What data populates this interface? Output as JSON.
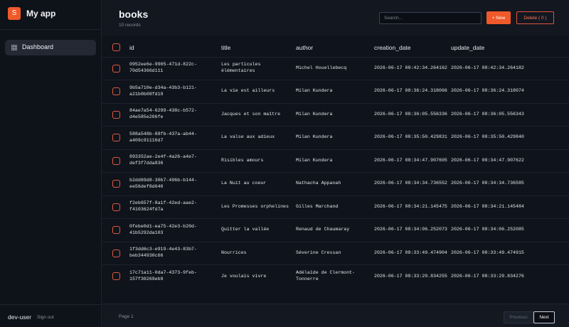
{
  "app": {
    "logo_letter": "S",
    "title": "My app"
  },
  "sidebar": {
    "items": [
      {
        "label": "Dashboard",
        "icon": "grid-icon"
      }
    ]
  },
  "user": {
    "name": "dev-user",
    "signout": "Sign out"
  },
  "header": {
    "title": "books",
    "subtitle": "10 records"
  },
  "search": {
    "placeholder": "Search..."
  },
  "toolbar": {
    "new_label": "+ New",
    "delete_label": "Delete ( 0 )"
  },
  "colors": {
    "accent": "#f0592a",
    "danger": "#e0553b",
    "background": "#0f131b"
  },
  "table": {
    "columns": [
      "id",
      "title",
      "author",
      "creation_date",
      "update_date"
    ],
    "rows": [
      [
        "0952ee6e-9905-471d-822c-70d54366d111",
        "Les particules élémentaires",
        "Michel Houellebecq",
        "2026-06-17 08:42:34.264162",
        "2026-06-17 08:42:34.264182"
      ],
      [
        "9b5a710e-d34a-43b3-b121-a21b0b08fd19",
        "La vie est ailleurs",
        "Milan Kundera",
        "2026-06-17 08:36:24.318066",
        "2026-06-17 08:36:24.318074"
      ],
      [
        "84ae7a54-6299-438c-b572-d4e585e206fe",
        "Jacques et son maître",
        "Milan Kundera",
        "2026-06-17 08:36:05.556336",
        "2026-06-17 08:36:05.556343"
      ],
      [
        "588a548b-88fb-437a-ab44-a409c91116d7",
        "La valse aux adieux",
        "Milan Kundera",
        "2026-06-17 08:35:50.429831",
        "2026-06-17 08:35:50.429840"
      ],
      [
        "893352ae-2e4f-4a26-a4e7-def3f7dda836",
        "Risibles amours",
        "Milan Kundera",
        "2026-06-17 08:34:47.907605",
        "2026-06-17 08:34:47.907622"
      ],
      [
        "b2dd69d8-30b7-496b-b144-ee56def8d640",
        "La Nuit au coeur",
        "Nathacha Appanah",
        "2026-06-17 08:34:34.736552",
        "2026-06-17 08:34:34.736585"
      ],
      [
        "f2eb657f-8a1f-42ed-aae2-f4103624fd7a",
        "Les Promesses orphelines",
        "Gilles Marchand",
        "2026-06-17 08:34:21.145475",
        "2026-06-17 08:34:21.145484"
      ],
      [
        "0febe0d1-ea75-42e3-b20d-41b5292da103",
        "Quitter la vallée",
        "Renaud de Chaumaray",
        "2026-06-17 08:34:06.252073",
        "2026-06-17 08:34:06.252085"
      ],
      [
        "1f3dd6c3-e919-4e43-83b7-beb344930c66",
        "Nourrices",
        "Séverine Cressan",
        "2026-06-17 08:33:49.474904",
        "2026-06-17 08:33:49.474915"
      ],
      [
        "17c71a11-0da7-4373-9feb-157f30269eb9",
        "Je voulais vivre",
        "Adélaïde de Clermont-Tonnerre",
        "2026-06-17 08:33:29.834255",
        "2026-06-17 08:33:29.834276"
      ]
    ]
  },
  "pagination": {
    "label": "Page 1",
    "prev_label": "Previous",
    "next_label": "Next"
  }
}
